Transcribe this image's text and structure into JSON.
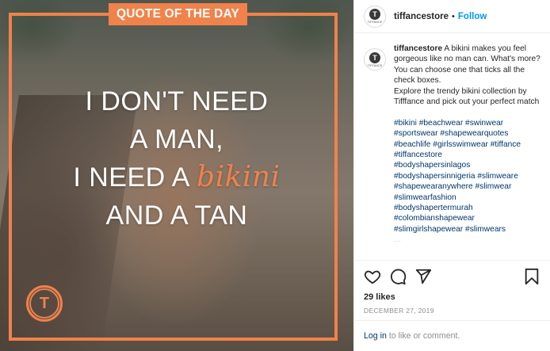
{
  "post_image": {
    "banner": "QUOTE OF THE DAY",
    "quote_lines": [
      "I DON'T NEED",
      "A MAN,",
      "I NEED A",
      "AND A TAN"
    ],
    "quote_highlight": "bikini",
    "logo_letter": "T",
    "accent_color": "#f0824a"
  },
  "header": {
    "username": "tiffancestore",
    "separator": "•",
    "follow_label": "Follow",
    "avatar_letter": "T",
    "avatar_caption": "TIFFANCE"
  },
  "caption": {
    "username": "tiffancestore",
    "text_1": "A bikini makes you feel gorgeous like no man can. What's more? You can choose one that ticks all the check boxes.",
    "text_2": "Explore the trendy bikini collection by Tifffance and pick out your perfect match",
    "hashtags": [
      "#bikini #beachwear #swinwear",
      "#sportswear #shapewearquotes",
      "#beachlife #girlsswimwear #tiffance",
      "#tiffancestore",
      "#bodyshapersinlagos",
      "#bodyshapersinnigeria #slimweare",
      "#shapewearanywhere #slimwear",
      "#slimwearfashion",
      "#bodyshapertermurah",
      "#colombianshapewear",
      "#slimgirlshapewear #slimwears"
    ],
    "more": "…"
  },
  "actions": {
    "like_icon": "heart-icon",
    "comment_icon": "comment-icon",
    "share_icon": "share-icon",
    "save_icon": "bookmark-icon"
  },
  "likes": "29 likes",
  "date": "DECEMBER 27, 2019",
  "login": {
    "link": "Log in",
    "text": "to like or comment."
  }
}
